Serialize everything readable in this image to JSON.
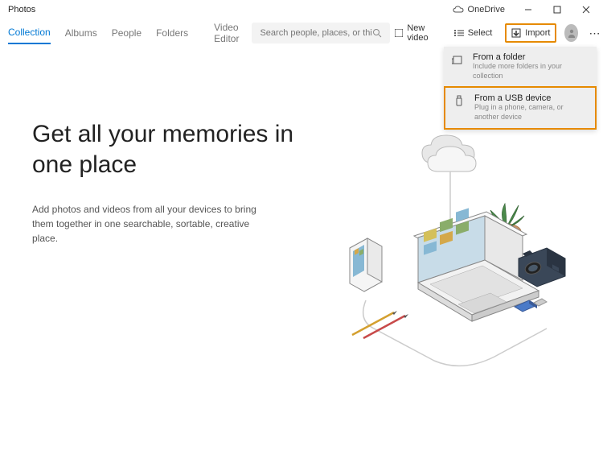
{
  "titlebar": {
    "app_name": "Photos",
    "onedrive_label": "OneDrive"
  },
  "tabs": {
    "collection": "Collection",
    "albums": "Albums",
    "people": "People",
    "folders": "Folders",
    "video_editor": "Video Editor"
  },
  "search": {
    "placeholder": "Search people, places, or things..."
  },
  "actions": {
    "new_video": "New video",
    "select": "Select",
    "import": "Import"
  },
  "dropdown": {
    "folder": {
      "title": "From a folder",
      "subtitle": "Include more folders in your collection"
    },
    "usb": {
      "title": "From a USB device",
      "subtitle": "Plug in a phone, camera, or another device"
    }
  },
  "hero": {
    "heading": "Get all your memories in one place",
    "body": "Add photos and videos from all your devices to bring them together in one searchable, sortable, creative place."
  },
  "colors": {
    "accent": "#0078d4",
    "highlight": "#e68a00"
  }
}
